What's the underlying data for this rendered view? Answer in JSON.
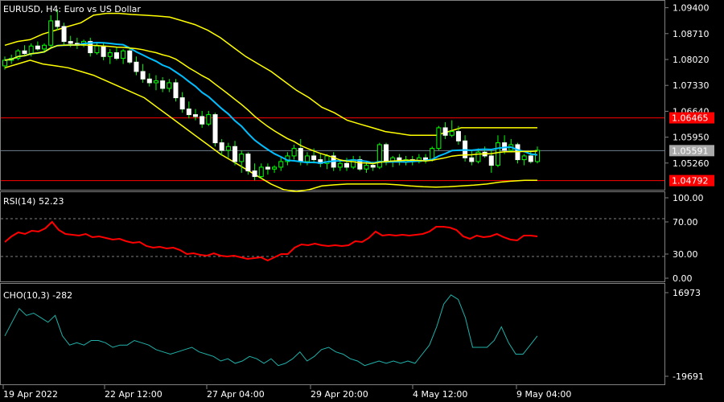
{
  "header": {
    "symbol_label": "EURUSD, H4:  Euro vs US Dollar",
    "rsi_label": "RSI(14) 52.23",
    "cho_label": "CHO(10,3) -282"
  },
  "colors": {
    "background": "#000000",
    "frame": "#808080",
    "bull_candle": "#00ff00",
    "bear_candle": "#ffffff",
    "bollinger": "#ffff00",
    "ma": "#00bfff",
    "rsi": "#ff0000",
    "cho": "#20b2aa",
    "levels": "#ff0000"
  },
  "price_axis": {
    "ticks": [
      "1.09400",
      "1.08710",
      "1.08020",
      "1.07330",
      "1.06640",
      "1.05950",
      "1.05260"
    ],
    "tick_values": [
      1.094,
      1.0871,
      1.0802,
      1.0733,
      1.0664,
      1.0595,
      1.0526
    ],
    "range": [
      1.0457,
      1.0952
    ]
  },
  "price_tags": {
    "upper_level": "1.06465",
    "current": "1.05591",
    "lower_level": "1.04792",
    "upper_value": 1.06465,
    "current_value": 1.05591,
    "lower_value": 1.04792
  },
  "rsi_axis": {
    "ticks": [
      "100.00",
      "70.00",
      "30.00",
      "0.00"
    ],
    "tick_values": [
      100,
      70,
      30,
      0
    ]
  },
  "cho_axis": {
    "ticks": [
      "16973",
      "-19691"
    ],
    "tick_values": [
      16973,
      -19691
    ]
  },
  "time_axis": [
    "19 Apr 2022",
    "22 Apr 12:00",
    "27 Apr 04:00",
    "29 Apr 20:00",
    "4 May 12:00",
    "9 May 04:00"
  ],
  "chart_data": {
    "type": "candlestick",
    "symbol": "EURUSD",
    "timeframe": "H4",
    "candles": [
      [
        1.0785,
        1.081,
        1.0775,
        1.08
      ],
      [
        1.08,
        1.0815,
        1.079,
        1.0805
      ],
      [
        1.0805,
        1.083,
        1.08,
        1.0825
      ],
      [
        1.0825,
        1.084,
        1.0815,
        1.0818
      ],
      [
        1.0818,
        1.0845,
        1.081,
        1.0838
      ],
      [
        1.0838,
        1.085,
        1.0825,
        1.083
      ],
      [
        1.083,
        1.0845,
        1.082,
        1.084
      ],
      [
        1.084,
        1.092,
        1.0835,
        1.0905
      ],
      [
        1.0905,
        1.0935,
        1.088,
        1.089
      ],
      [
        1.089,
        1.09,
        1.084,
        1.085
      ],
      [
        1.085,
        1.0865,
        1.0835,
        1.0845
      ],
      [
        1.0845,
        1.086,
        1.083,
        1.084
      ],
      [
        1.084,
        1.0855,
        1.0835,
        1.085
      ],
      [
        1.085,
        1.086,
        1.081,
        1.082
      ],
      [
        1.082,
        1.0845,
        1.0815,
        1.0838
      ],
      [
        1.0838,
        1.0845,
        1.08,
        1.081
      ],
      [
        1.081,
        1.083,
        1.079,
        1.082
      ],
      [
        1.082,
        1.0835,
        1.08,
        1.0805
      ],
      [
        1.0805,
        1.083,
        1.079,
        1.0825
      ],
      [
        1.0825,
        1.083,
        1.079,
        1.0795
      ],
      [
        1.0795,
        1.081,
        1.076,
        1.077
      ],
      [
        1.077,
        1.079,
        1.074,
        1.075
      ],
      [
        1.075,
        1.0765,
        1.073,
        1.074
      ],
      [
        1.074,
        1.076,
        1.072,
        1.0745
      ],
      [
        1.0745,
        1.0755,
        1.0715,
        1.0725
      ],
      [
        1.0725,
        1.075,
        1.0715,
        1.074
      ],
      [
        1.074,
        1.075,
        1.069,
        1.07
      ],
      [
        1.07,
        1.0715,
        1.066,
        1.067
      ],
      [
        1.067,
        1.069,
        1.0645,
        1.0655
      ],
      [
        1.0655,
        1.067,
        1.064,
        1.065
      ],
      [
        1.065,
        1.0665,
        1.062,
        1.063
      ],
      [
        1.063,
        1.0665,
        1.0625,
        1.0655
      ],
      [
        1.0655,
        1.066,
        1.057,
        1.058
      ],
      [
        1.058,
        1.059,
        1.0545,
        1.056
      ],
      [
        1.056,
        1.058,
        1.054,
        1.057
      ],
      [
        1.057,
        1.0585,
        1.052,
        1.053
      ],
      [
        1.053,
        1.056,
        1.05,
        1.055
      ],
      [
        1.055,
        1.0555,
        1.0495,
        1.0505
      ],
      [
        1.0505,
        1.0525,
        1.048,
        1.049
      ],
      [
        1.049,
        1.0525,
        1.0485,
        1.0515
      ],
      [
        1.0515,
        1.0525,
        1.0495,
        1.051
      ],
      [
        1.051,
        1.052,
        1.05,
        1.0515
      ],
      [
        1.0515,
        1.054,
        1.0505,
        1.053
      ],
      [
        1.053,
        1.0555,
        1.052,
        1.0545
      ],
      [
        1.0545,
        1.0575,
        1.0535,
        1.0565
      ],
      [
        1.0565,
        1.059,
        1.052,
        1.053
      ],
      [
        1.053,
        1.0555,
        1.052,
        1.0545
      ],
      [
        1.0545,
        1.0565,
        1.0525,
        1.0535
      ],
      [
        1.0535,
        1.055,
        1.0515,
        1.0525
      ],
      [
        1.0525,
        1.055,
        1.051,
        1.0545
      ],
      [
        1.0545,
        1.0555,
        1.0505,
        1.0515
      ],
      [
        1.0515,
        1.0535,
        1.0505,
        1.0525
      ],
      [
        1.0525,
        1.054,
        1.0505,
        1.0515
      ],
      [
        1.0515,
        1.0545,
        1.051,
        1.0535
      ],
      [
        1.0535,
        1.0545,
        1.0505,
        1.051
      ],
      [
        1.051,
        1.053,
        1.05,
        1.052
      ],
      [
        1.052,
        1.053,
        1.0505,
        1.0515
      ],
      [
        1.0515,
        1.058,
        1.051,
        1.0575
      ],
      [
        1.0575,
        1.058,
        1.052,
        1.053
      ],
      [
        1.053,
        1.0545,
        1.0515,
        1.054
      ],
      [
        1.054,
        1.055,
        1.052,
        1.053
      ],
      [
        1.053,
        1.0545,
        1.052,
        1.0535
      ],
      [
        1.0535,
        1.0545,
        1.052,
        1.053
      ],
      [
        1.053,
        1.055,
        1.0525,
        1.054
      ],
      [
        1.054,
        1.055,
        1.0525,
        1.0535
      ],
      [
        1.0535,
        1.057,
        1.053,
        1.0565
      ],
      [
        1.0565,
        1.0625,
        1.056,
        1.062
      ],
      [
        1.062,
        1.0635,
        1.059,
        1.06
      ],
      [
        1.06,
        1.064,
        1.0595,
        1.061
      ],
      [
        1.061,
        1.0625,
        1.0575,
        1.0585
      ],
      [
        1.0585,
        1.06,
        1.053,
        1.054
      ],
      [
        1.054,
        1.056,
        1.052,
        1.053
      ],
      [
        1.053,
        1.0565,
        1.0525,
        1.0555
      ],
      [
        1.0555,
        1.057,
        1.054,
        1.0545
      ],
      [
        1.0545,
        1.056,
        1.05,
        1.052
      ],
      [
        1.052,
        1.06,
        1.0515,
        1.058
      ],
      [
        1.058,
        1.06,
        1.055,
        1.056
      ],
      [
        1.056,
        1.059,
        1.0555,
        1.0575
      ],
      [
        1.0575,
        1.058,
        1.0525,
        1.0535
      ],
      [
        1.0535,
        1.055,
        1.052,
        1.0545
      ],
      [
        1.0545,
        1.056,
        1.0525,
        1.053
      ],
      [
        1.053,
        1.057,
        1.0525,
        1.056
      ]
    ],
    "rsi": [
      45,
      52,
      57,
      55,
      59,
      58,
      62,
      70,
      60,
      55,
      54,
      53,
      55,
      51,
      52,
      50,
      48,
      49,
      46,
      44,
      45,
      40,
      38,
      39,
      37,
      38,
      35,
      30,
      31,
      29,
      28,
      31,
      28,
      27,
      28,
      26,
      24,
      25,
      26,
      22,
      26,
      30,
      30,
      38,
      42,
      41,
      43,
      41,
      40,
      41,
      40,
      41,
      46,
      45,
      50,
      58,
      53,
      54,
      53,
      54,
      53,
      54,
      55,
      58,
      64,
      64,
      63,
      60,
      52,
      49,
      53,
      51,
      52,
      55,
      51,
      48,
      47,
      53,
      53,
      52
    ],
    "cho": [
      -2000,
      4000,
      10000,
      7000,
      8000,
      6000,
      4000,
      7000,
      -2000,
      -6000,
      -5000,
      -6000,
      -4000,
      -4000,
      -5000,
      -7000,
      -6000,
      -6000,
      -4000,
      -5000,
      -6000,
      -8000,
      -9000,
      -10000,
      -9000,
      -8000,
      -7000,
      -9000,
      -10000,
      -11000,
      -13000,
      -12000,
      -14000,
      -13000,
      -11000,
      -12000,
      -14000,
      -12000,
      -15000,
      -14000,
      -12000,
      -9000,
      -13000,
      -11000,
      -8000,
      -7000,
      -9000,
      -10000,
      -12000,
      -13000,
      -15000,
      -14000,
      -13000,
      -14000,
      -13000,
      -14000,
      -13000,
      -14000,
      -10000,
      -6000,
      2000,
      12000,
      16000,
      14000,
      6000,
      -7000,
      -7000,
      -7000,
      -4000,
      2000,
      -5000,
      -10000,
      -10000,
      -6000,
      -2000
    ],
    "bb_upper": [
      1.084,
      1.085,
      1.0855,
      1.087,
      1.088,
      1.089,
      1.09,
      1.092,
      1.0925,
      1.0925,
      1.0922,
      1.092,
      1.0918,
      1.0915,
      1.0905,
      1.0895,
      1.088,
      1.086,
      1.0835,
      1.081,
      1.079,
      1.077,
      1.0745,
      1.072,
      1.07,
      1.0675,
      1.066,
      1.064,
      1.063,
      1.062,
      1.061,
      1.0605,
      1.06,
      1.06,
      1.06,
      1.061,
      1.062,
      1.062,
      1.062,
      1.062,
      1.062,
      1.062,
      1.062
    ],
    "bb_lower": [
      1.078,
      1.079,
      1.08,
      1.079,
      1.0785,
      1.078,
      1.077,
      1.076,
      1.0745,
      1.073,
      1.0715,
      1.07,
      1.0675,
      1.065,
      1.0625,
      1.06,
      1.0575,
      1.055,
      1.053,
      1.051,
      1.049,
      1.047,
      1.0455,
      1.045,
      1.0455,
      1.0465,
      1.0468,
      1.047,
      1.047,
      1.047,
      1.047,
      1.0468,
      1.0465,
      1.0463,
      1.0462,
      1.0463,
      1.0465,
      1.0467,
      1.047,
      1.0475,
      1.0478,
      1.048,
      1.048
    ]
  }
}
